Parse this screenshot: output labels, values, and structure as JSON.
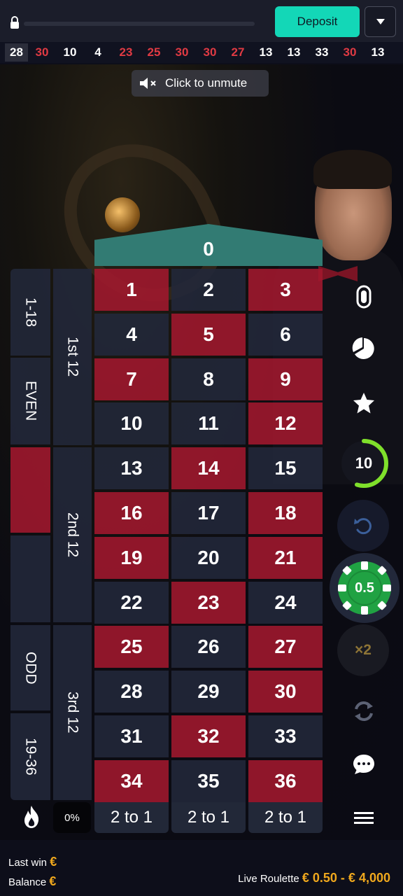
{
  "header": {
    "deposit_label": "Deposit"
  },
  "history": [
    {
      "value": "28",
      "color": "black"
    },
    {
      "value": "30",
      "color": "red"
    },
    {
      "value": "10",
      "color": "black"
    },
    {
      "value": "4",
      "color": "black"
    },
    {
      "value": "23",
      "color": "red"
    },
    {
      "value": "25",
      "color": "red"
    },
    {
      "value": "30",
      "color": "red"
    },
    {
      "value": "30",
      "color": "red"
    },
    {
      "value": "27",
      "color": "red"
    },
    {
      "value": "13",
      "color": "black"
    },
    {
      "value": "13",
      "color": "black"
    },
    {
      "value": "33",
      "color": "black"
    },
    {
      "value": "30",
      "color": "red"
    },
    {
      "value": "13",
      "color": "black"
    }
  ],
  "unmute_label": "Click to unmute",
  "table": {
    "zero": "0",
    "numbers": [
      [
        "1",
        "2",
        "3"
      ],
      [
        "4",
        "5",
        "6"
      ],
      [
        "7",
        "8",
        "9"
      ],
      [
        "10",
        "11",
        "12"
      ],
      [
        "13",
        "14",
        "15"
      ],
      [
        "16",
        "17",
        "18"
      ],
      [
        "19",
        "20",
        "21"
      ],
      [
        "22",
        "23",
        "24"
      ],
      [
        "25",
        "26",
        "27"
      ],
      [
        "28",
        "29",
        "30"
      ],
      [
        "31",
        "32",
        "33"
      ],
      [
        "34",
        "35",
        "36"
      ]
    ],
    "reds": [
      "1",
      "3",
      "5",
      "7",
      "9",
      "12",
      "14",
      "16",
      "18",
      "19",
      "21",
      "23",
      "25",
      "27",
      "30",
      "32",
      "34",
      "36"
    ],
    "dozens": [
      "1st 12",
      "2nd 12",
      "3rd 12"
    ],
    "outside": {
      "low": "1-18",
      "even": "EVEN",
      "odd": "ODD",
      "high": "19-36"
    },
    "columns": [
      "2 to 1",
      "2 to 1",
      "2 to 1"
    ],
    "hot_percent": "0%"
  },
  "controls": {
    "timer": "10",
    "timer_progress": 0.55,
    "chip_value": "0.5",
    "double_label": "×2"
  },
  "footer": {
    "last_win_label": "Last win",
    "balance_label": "Balance",
    "currency": "€",
    "game_name": "Live Roulette",
    "limits": "€ 0.50 - € 4,000"
  },
  "colors": {
    "accent": "#13d7b7",
    "red": "#a2182e",
    "green_zero": "#327b73",
    "gold": "#f0a81d"
  }
}
